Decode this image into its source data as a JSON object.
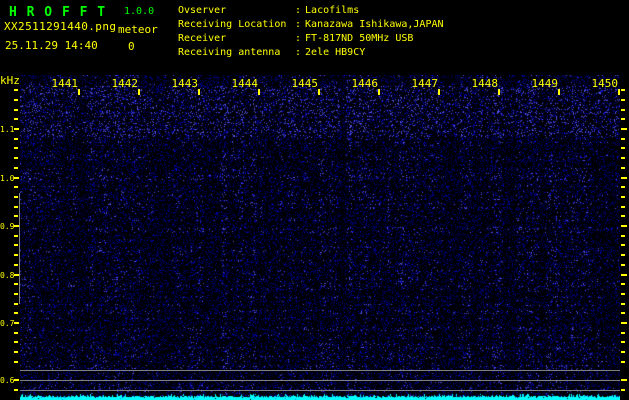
{
  "header": {
    "app_title": "H R O F F T",
    "version": "1.0.0",
    "filename": "XX2511291440.png",
    "meteor_label": "meteor",
    "meteor_count": "0",
    "datetime": "25.11.29 14:40",
    "separator": ":",
    "info": [
      {
        "label": "Ovserver",
        "value": "Lacofilms"
      },
      {
        "label": "Receiving Location",
        "value": "Kanazawa Ishikawa,JAPAN"
      },
      {
        "label": "Receiver",
        "value": "FT-817ND 50MHz USB"
      },
      {
        "label": "Receiving antenna",
        "value": "2ele HB9CY"
      }
    ]
  },
  "chart_data": {
    "type": "heatmap",
    "title": "HROFFT radio meteor echo spectrogram",
    "x_tick_labels": [
      "1441",
      "1442",
      "1443",
      "1444",
      "1445",
      "1446",
      "1447",
      "1448",
      "1449",
      "1450"
    ],
    "y_tick_labels": [
      "1.1",
      "1.0",
      "0.9",
      "0.8",
      "0.7",
      "0.6"
    ],
    "ylabel": "kHz",
    "content": "blue background noise speckle only, no meteor echoes; cyan signal-level trace along bottom edge; three gray horizontal level lines near 0.6 kHz"
  },
  "colors": {
    "title_green": "#00ff00",
    "text_yellow": "#ffff00",
    "grid_gray": "#808080",
    "level_trace_cyan": "#00ffff",
    "noise_blue": "#0000ff",
    "background": "#000000"
  }
}
